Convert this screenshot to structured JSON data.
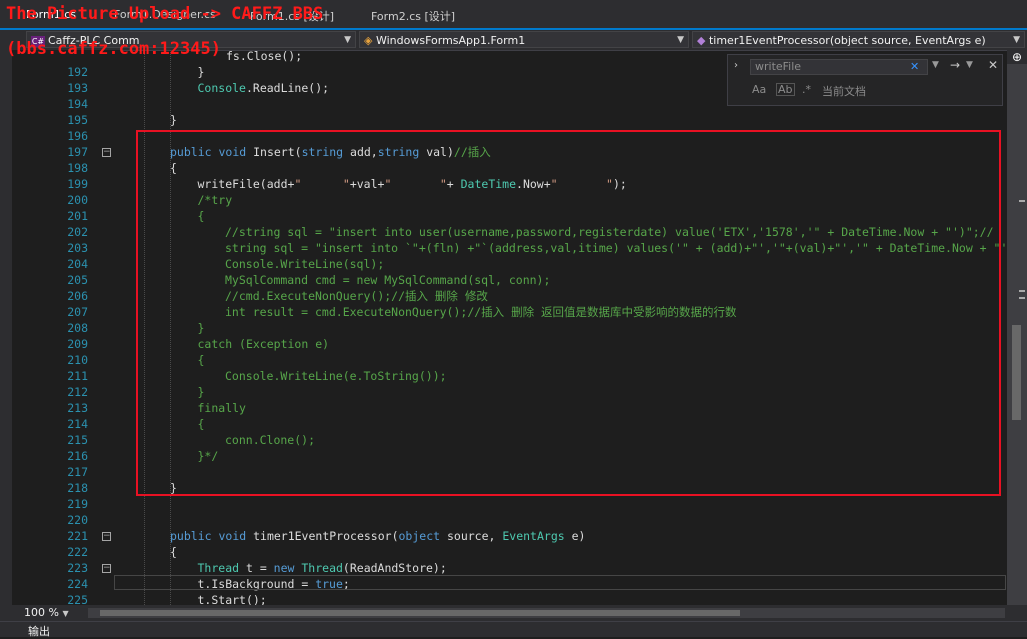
{
  "watermark": {
    "line1": "The Picture Upload -> CAFFZ BBS",
    "line2": "(bbs.caffz.com:12345)"
  },
  "tabs": [
    {
      "label": "Form1.cs",
      "active": true
    },
    {
      "label": "Form1.Designer.cs"
    },
    {
      "label": "Form1.cs [设计]"
    },
    {
      "label": "Form2.cs [设计]"
    }
  ],
  "nav": {
    "project": "Caffz-PLC Comm",
    "class": "WindowsFormsApp1.Form1",
    "member": "timer1EventProcessor(object source, EventArgs e)"
  },
  "find": {
    "value": "writeFile",
    "scope": "当前文档",
    "opt_case": "Aa",
    "opt_word": "Ab",
    "opt_regex": ".*"
  },
  "zoom": "100 %",
  "output_label": "输出",
  "colors": {
    "accent": "#007acc",
    "highlight_box": "#e81123",
    "keyword": "#569cd6",
    "type": "#4ec9b0",
    "string": "#d69d85",
    "comment": "#57a64a",
    "line_number": "#2b91af"
  },
  "lines": [
    {
      "n": "192",
      "indent": 4,
      "tokens": [
        [
          "t",
          "}"
        ]
      ]
    },
    {
      "n": "193",
      "indent": 4,
      "tokens": [
        [
          "ty",
          "Console"
        ],
        [
          "t",
          ".ReadLine();"
        ]
      ]
    },
    {
      "n": "194",
      "indent": 0,
      "tokens": []
    },
    {
      "n": "195",
      "indent": 3,
      "tokens": [
        [
          "t",
          "}"
        ]
      ]
    },
    {
      "n": "196",
      "indent": 0,
      "tokens": []
    },
    {
      "n": "197",
      "indent": 3,
      "fold": true,
      "tokens": [
        [
          "kw",
          "public "
        ],
        [
          "kw",
          "void "
        ],
        [
          "t",
          "Insert("
        ],
        [
          "kw",
          "string "
        ],
        [
          "t",
          "add,"
        ],
        [
          "kw",
          "string "
        ],
        [
          "t",
          "val)"
        ],
        [
          "cm",
          "//插入"
        ]
      ]
    },
    {
      "n": "198",
      "indent": 3,
      "tokens": [
        [
          "t",
          "{"
        ]
      ]
    },
    {
      "n": "199",
      "indent": 4,
      "tokens": [
        [
          "t",
          "writeFile(add+"
        ],
        [
          "st",
          "\"      \""
        ],
        [
          "t",
          "+val+"
        ],
        [
          "st",
          "\"       \""
        ],
        [
          "t",
          "+ "
        ],
        [
          "ty",
          "DateTime"
        ],
        [
          "t",
          ".Now+"
        ],
        [
          "st",
          "\"       \""
        ],
        [
          "t",
          ");"
        ]
      ]
    },
    {
      "n": "200",
      "indent": 4,
      "tokens": [
        [
          "cm",
          "/*try"
        ]
      ]
    },
    {
      "n": "201",
      "indent": 4,
      "tokens": [
        [
          "cm",
          "{"
        ]
      ]
    },
    {
      "n": "202",
      "indent": 5,
      "tokens": [
        [
          "cm",
          "//string sql = \"insert into user(username,password,registerdate) value('ETX','1578','\" + DateTime.Now + \"')\";//"
        ]
      ]
    },
    {
      "n": "203",
      "indent": 5,
      "tokens": [
        [
          "cm",
          "string sql = \"insert into `\"+(fln) +\"`(address,val,itime) values('\" + (add)+\"','\"+(val)+\"','\" + DateTime.Now + \"')\";"
        ]
      ]
    },
    {
      "n": "204",
      "indent": 5,
      "tokens": [
        [
          "cm",
          "Console.WriteLine(sql);"
        ]
      ]
    },
    {
      "n": "205",
      "indent": 5,
      "tokens": [
        [
          "cm",
          "MySqlCommand cmd = new MySqlCommand(sql, conn);"
        ]
      ]
    },
    {
      "n": "206",
      "indent": 5,
      "tokens": [
        [
          "cm",
          "//cmd.ExecuteNonQuery();//插入 删除 修改"
        ]
      ]
    },
    {
      "n": "207",
      "indent": 5,
      "tokens": [
        [
          "cm",
          "int result = cmd.ExecuteNonQuery();//插入 删除 返回值是数据库中受影响的数据的行数"
        ]
      ]
    },
    {
      "n": "208",
      "indent": 4,
      "tokens": [
        [
          "cm",
          "}"
        ]
      ]
    },
    {
      "n": "209",
      "indent": 4,
      "tokens": [
        [
          "cm",
          "catch (Exception e)"
        ]
      ]
    },
    {
      "n": "210",
      "indent": 4,
      "tokens": [
        [
          "cm",
          "{"
        ]
      ]
    },
    {
      "n": "211",
      "indent": 5,
      "tokens": [
        [
          "cm",
          "Console.WriteLine(e.ToString());"
        ]
      ]
    },
    {
      "n": "212",
      "indent": 4,
      "tokens": [
        [
          "cm",
          "}"
        ]
      ]
    },
    {
      "n": "213",
      "indent": 4,
      "tokens": [
        [
          "cm",
          "finally"
        ]
      ]
    },
    {
      "n": "214",
      "indent": 4,
      "tokens": [
        [
          "cm",
          "{"
        ]
      ]
    },
    {
      "n": "215",
      "indent": 5,
      "tokens": [
        [
          "cm",
          "conn.Clone();"
        ]
      ]
    },
    {
      "n": "216",
      "indent": 4,
      "tokens": [
        [
          "cm",
          "}*/"
        ]
      ]
    },
    {
      "n": "217",
      "indent": 0,
      "tokens": []
    },
    {
      "n": "218",
      "indent": 3,
      "tokens": [
        [
          "t",
          "}"
        ]
      ]
    },
    {
      "n": "219",
      "indent": 0,
      "tokens": []
    },
    {
      "n": "220",
      "indent": 0,
      "tokens": []
    },
    {
      "n": "221",
      "indent": 3,
      "fold": true,
      "tokens": [
        [
          "kw",
          "public "
        ],
        [
          "kw",
          "void "
        ],
        [
          "t",
          "timer1EventProcessor("
        ],
        [
          "kw",
          "object "
        ],
        [
          "t",
          "source, "
        ],
        [
          "ty",
          "EventArgs "
        ],
        [
          "t",
          "e)"
        ]
      ]
    },
    {
      "n": "222",
      "indent": 3,
      "tokens": [
        [
          "t",
          "{"
        ]
      ]
    },
    {
      "n": "223",
      "indent": 4,
      "fold": true,
      "tokens": [
        [
          "ty",
          "Thread "
        ],
        [
          "t",
          "t = "
        ],
        [
          "kw",
          "new "
        ],
        [
          "ty",
          "Thread"
        ],
        [
          "t",
          "(ReadAndStore);"
        ]
      ]
    },
    {
      "n": "224",
      "indent": 4,
      "tokens": [
        [
          "t",
          "t.IsBackground = "
        ],
        [
          "kw",
          "true"
        ],
        [
          "t",
          ";"
        ]
      ]
    },
    {
      "n": "225",
      "indent": 4,
      "tokens": [
        [
          "t",
          "t.Start();"
        ]
      ]
    }
  ],
  "top_partial": "fs.Close();"
}
